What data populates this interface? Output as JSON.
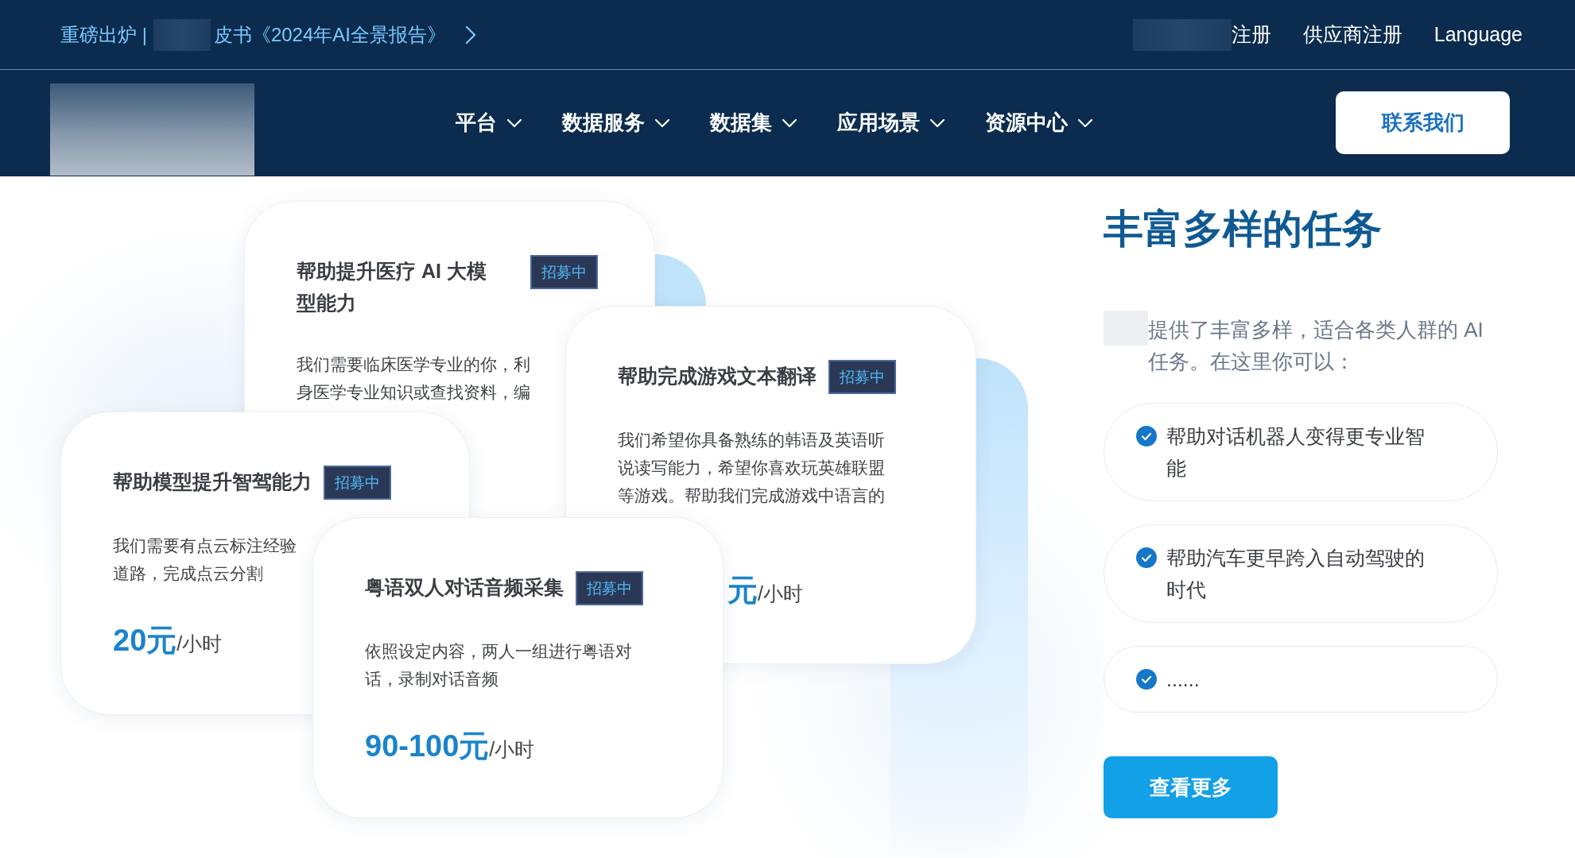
{
  "announcement": {
    "prefix": "重磅出炉 |",
    "text": "皮书《2024年AI全景报告》"
  },
  "account_links": [
    "注册",
    "供应商注册",
    "Language"
  ],
  "nav": {
    "items": [
      {
        "label": "平台"
      },
      {
        "label": "数据服务"
      },
      {
        "label": "数据集"
      },
      {
        "label": "应用场景"
      },
      {
        "label": "资源中心"
      }
    ],
    "contact_button": "联系我们"
  },
  "task_cards": [
    {
      "title": "帮助提升医疗 AI 大模型能力",
      "badge": "招募中",
      "description_lines": [
        "我们需要临床医学专业的你，利",
        "身医学专业知识或查找资料，编"
      ]
    },
    {
      "title": "帮助模型提升智驾能力",
      "badge": "招募中",
      "description_lines": [
        "我们需要有点云标注经验",
        "道路，完成点云分割"
      ],
      "price": "20元",
      "unit": "/小时"
    },
    {
      "title": "帮助完成游戏文本翻译",
      "badge": "招募中",
      "description_lines": [
        "我们希望你具备熟练的韩语及英语听",
        "说读写能力，希望你喜欢玩英雄联盟",
        "等游戏。帮助我们完成游戏中语言的"
      ],
      "price": "元",
      "unit": "/小时"
    },
    {
      "title": "粤语双人对话音频采集",
      "badge": "招募中",
      "description_lines": [
        "依照设定内容，两人一组进行粤语对",
        "话，录制对话音频"
      ],
      "price": "90-100元",
      "unit": "/小时"
    }
  ],
  "features": {
    "title": "丰富多样的任务",
    "intro": "提供了丰富多样，适合各类人群的 AI 任务。在这里你可以：",
    "items": [
      {
        "text": "帮助对话机器人变得更专业智能"
      },
      {
        "text": "帮助汽车更早跨入自动驾驶的时代"
      },
      {
        "text": "......"
      }
    ],
    "button": "查看更多"
  }
}
